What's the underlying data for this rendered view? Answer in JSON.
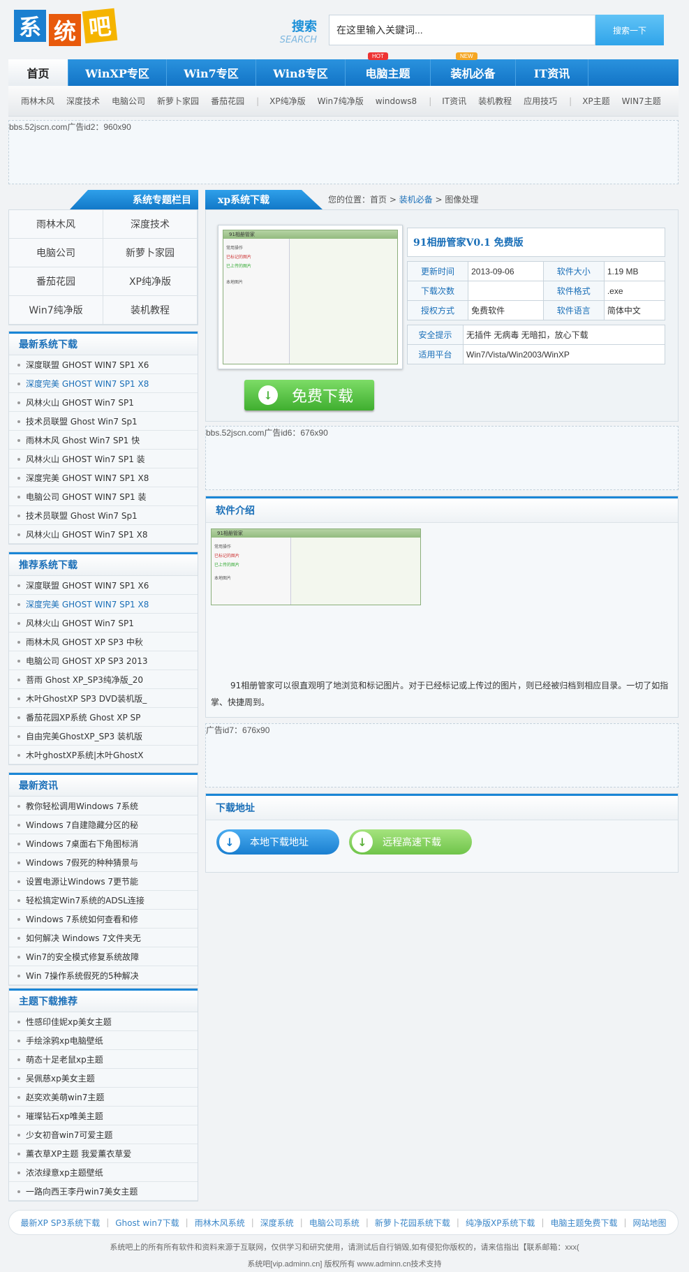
{
  "logo": {
    "chars": [
      "系",
      "统",
      "吧"
    ],
    "colors": [
      "#1a7fd0",
      "#e85a0c",
      "#f5b400"
    ]
  },
  "search": {
    "label_cn": "搜索",
    "label_en": "SEARCH",
    "placeholder": "在这里输入关鍵词...",
    "value": "在这里输入关鍵词...",
    "button": "搜索一下"
  },
  "nav": {
    "items": [
      "首页",
      "WinXP专区",
      "Win7专区",
      "Win8专区",
      "电脑主题",
      "装机必备",
      "IT资讯"
    ],
    "badge_hot": "HOT",
    "badge_new": "NEW"
  },
  "subnav": {
    "group1": [
      "雨林木风",
      "深度技术",
      "电脑公司",
      "新萝卜家园",
      "番茄花园"
    ],
    "group2": [
      "XP纯净版",
      "Win7纯净版",
      "windows8"
    ],
    "group3": [
      "IT资讯",
      "装机教程",
      "应用技巧"
    ],
    "group4": [
      "XP主题",
      "WIN7主题"
    ]
  },
  "ads": {
    "top": "bbs.52jscn.com广告id2：960x90",
    "mid": "bbs.52jscn.com广告id6：676x90",
    "low": "广告id7：676x90"
  },
  "side": {
    "title": "系统专题栏目",
    "grid": [
      "雨林木风",
      "深度技术",
      "电脑公司",
      "新萝卜家园",
      "番茄花园",
      "XP纯净版",
      "Win7纯净版",
      "装机教程"
    ],
    "latest_title": "最新系统下载",
    "latest": [
      "深度联盟 GHOST WIN7 SP1 X6",
      "深度完美 GHOST WIN7 SP1 X8",
      "风林火山 GHOST Win7 SP1",
      "技术员联盟 Ghost Win7 Sp1",
      "雨林木风 Ghost Win7 SP1 快",
      "风林火山 GHOST Win7 SP1 装",
      "深度完美 GHOST WIN7 SP1 X8",
      "电脑公司 GHOST WIN7 SP1 装",
      "技术员联盟 Ghost Win7 Sp1",
      "风林火山 GHOST Win7 SP1 X8"
    ],
    "recommend_title": "推荐系统下载",
    "recommend": [
      "深度联盟 GHOST WIN7 SP1 X6",
      "深度完美 GHOST WIN7 SP1 X8",
      "风林火山 GHOST Win7 SP1",
      "雨林木风 GHOST XP SP3 中秋",
      "电脑公司 GHOST XP SP3 2013",
      "菩雨 Ghost XP_SP3纯净版_20",
      "木叶GhostXP SP3 DVD装机版_",
      "番茄花园XP系统 Ghost XP SP",
      "自由完美GhostXP_SP3 装机版",
      "木叶ghostXP系统|木叶GhostX"
    ],
    "news_title": "最新资讯",
    "news": [
      "教你轻松调用Windows 7系统",
      "Windows 7自建隐藏分区的秘",
      "Windows 7桌面右下角图标消",
      "Windows 7假死的种种猜景与",
      "设置电源让Windows 7更节能",
      "轻松搞定Win7系统的ADSL连接",
      "Windows 7系统如何查看和修",
      "如何解决 Windows 7文件夹无",
      "Win7的安全模式修复系统故障",
      "Win 7操作系统假死的5种解决"
    ],
    "theme_title": "主题下载推荐",
    "themes": [
      "性感印佳妮xp美女主题",
      "手绘涂鸦xp电脑壁纸",
      "萌态十足老鼠xp主题",
      "吴佩慈xp美女主题",
      "赵奕欢美萌win7主题",
      "璀璨钻石xp唯美主题",
      "少女初音win7可爱主题",
      "薰衣草XP主题 我爱薰衣草爱",
      "浓浓绿意xp主题壁纸",
      "一路向西王李丹win7美女主题"
    ]
  },
  "main": {
    "title": "xp系统下载",
    "breadcrumb": {
      "prefix": "您的位置：首页 > ",
      "mid": "装机必备",
      "sep": " > ",
      "last": "图像处理"
    },
    "soft_name": "91相册管家V0.1 免费版",
    "shot": {
      "win_title": "91相册管家",
      "item1": "常用操作",
      "item2": "已标记的图片",
      "item3": "已上传的图片",
      "item4": "本地图片"
    },
    "info": [
      [
        "更新时间",
        "2013-09-06",
        "软件大小",
        "1.19 MB"
      ],
      [
        "下载次数",
        "",
        "软件格式",
        ".exe"
      ],
      [
        "授权方式",
        "免费软件",
        "软件语言",
        "简体中文"
      ]
    ],
    "safety_label": "安全提示",
    "safety": "无插件 无病毒 无暗扣，放心下载",
    "platform_label": "适用平台",
    "platform": "Win7/Vista/Win2003/WinXP",
    "download_btn": "免费下载",
    "intro_title": "软件介绍",
    "intro_text": "91相册管家可以很直观明了地浏览和标记图片。对于已经标记或上传过的图片，则已经被归档到相应目录。一切了如指掌、快捷周到。",
    "dl_title": "下载地址",
    "dl_local": "本地下载地址",
    "dl_remote": "远程高速下载"
  },
  "footer": {
    "links": [
      "最新XP SP3系统下载",
      "Ghost win7下载",
      "雨林木风系统",
      "深度系统",
      "电脑公司系统",
      "新萝卜花园系统下载",
      "纯净版XP系统下载",
      "电脑主题免费下载",
      "网站地图"
    ],
    "line1": "系统吧上的所有所有软件和资料来源于互联网，仅供学习和研究使用，请测试后自行销毁,如有侵犯你版权的，请来信指出【联系邮箱：xxx(",
    "line2": "系统吧[vip.adminn.cn] 版权所有 www.adminn.cn技术支持"
  },
  "colors": {
    "brand_blue": "#1a86d6",
    "download_green": "#3fae2f"
  }
}
